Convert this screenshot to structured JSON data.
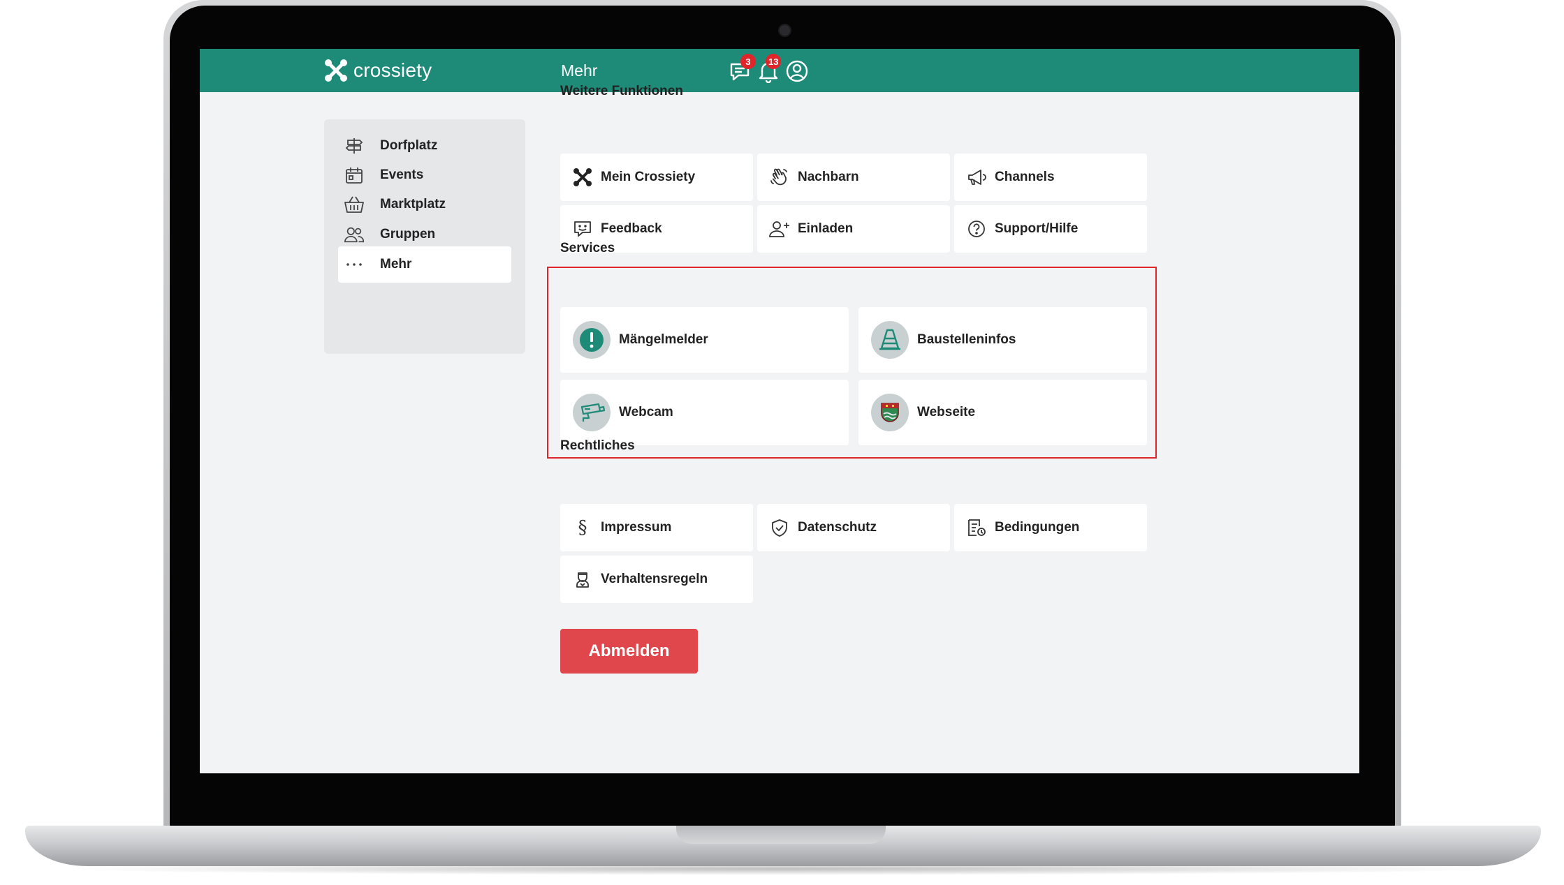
{
  "app": {
    "name": "crossiety",
    "page_title": "Mehr"
  },
  "header": {
    "messages_badge": "3",
    "notifications_badge": "13",
    "icons": [
      "chat-icon",
      "bell-icon",
      "profile-icon"
    ]
  },
  "sidebar": {
    "items": [
      {
        "label": "Dorfplatz",
        "icon": "signpost-icon",
        "active": false
      },
      {
        "label": "Events",
        "icon": "calendar-icon",
        "active": false
      },
      {
        "label": "Marktplatz",
        "icon": "basket-icon",
        "active": false
      },
      {
        "label": "Gruppen",
        "icon": "people-icon",
        "active": false
      },
      {
        "label": "Mehr",
        "icon": "more-dots-icon",
        "active": true
      }
    ]
  },
  "weitere": {
    "title": "Weitere Funktionen",
    "items": [
      {
        "label": "Mein Crossiety",
        "icon": "crossiety-icon"
      },
      {
        "label": "Nachbarn",
        "icon": "wave-hand-icon"
      },
      {
        "label": "Channels",
        "icon": "megaphone-icon"
      },
      {
        "label": "Feedback",
        "icon": "feedback-icon"
      },
      {
        "label": "Einladen",
        "icon": "add-user-icon"
      },
      {
        "label": "Support/Hilfe",
        "icon": "help-icon"
      }
    ]
  },
  "services": {
    "title": "Services",
    "items": [
      {
        "label": "Mängelmelder",
        "icon": "alert-icon"
      },
      {
        "label": "Baustelleninfos",
        "icon": "construction-cone-icon"
      },
      {
        "label": "Webcam",
        "icon": "camera-icon"
      },
      {
        "label": "Webseite",
        "icon": "coat-of-arms-icon"
      }
    ]
  },
  "rechtliches": {
    "title": "Rechtliches",
    "items": [
      {
        "label": "Impressum",
        "icon": "paragraph-icon"
      },
      {
        "label": "Datenschutz",
        "icon": "shield-icon"
      },
      {
        "label": "Bedingungen",
        "icon": "terms-icon"
      },
      {
        "label": "Verhaltensregeln",
        "icon": "conduct-icon"
      }
    ]
  },
  "logout_label": "Abmelden",
  "colors": {
    "brand": "#1e8a78",
    "danger": "#e0474c",
    "badge": "#e0252b",
    "highlight": "#e0252b"
  }
}
